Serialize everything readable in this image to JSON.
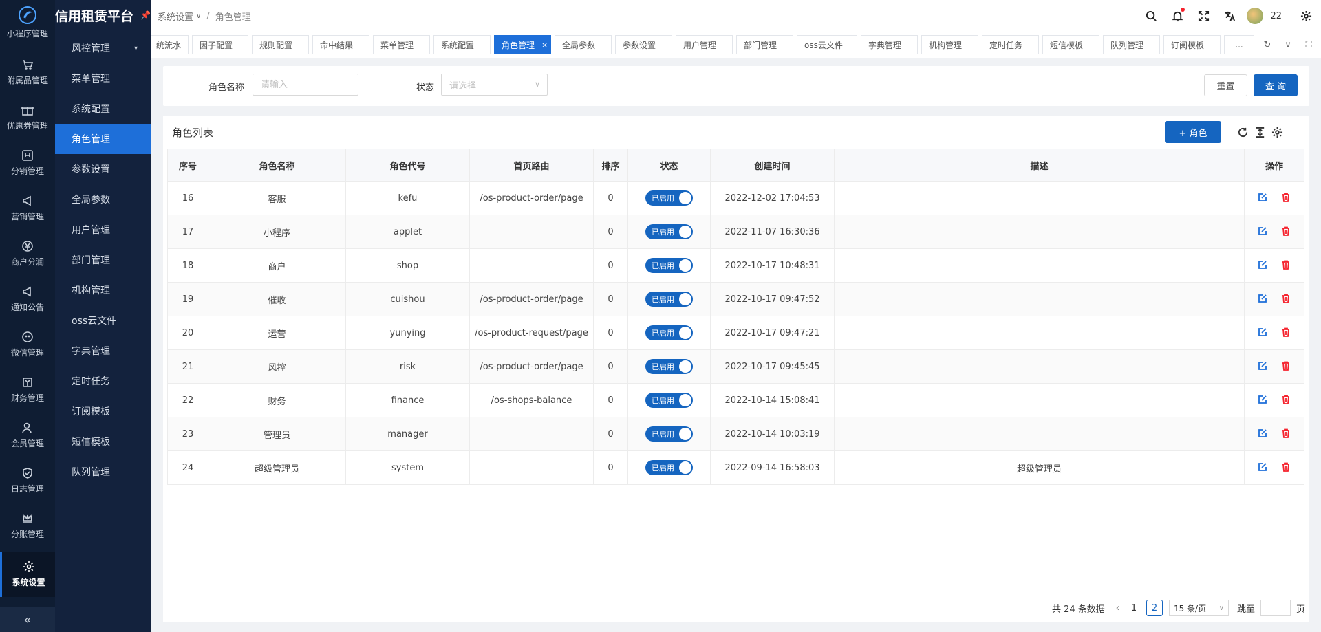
{
  "rail": {
    "items": [
      {
        "label": "小程序管理"
      },
      {
        "label": "附属品管理"
      },
      {
        "label": "优惠券管理"
      },
      {
        "label": "分销管理"
      },
      {
        "label": "营销管理"
      },
      {
        "label": "商户分润"
      },
      {
        "label": "通知公告"
      },
      {
        "label": "微信管理"
      },
      {
        "label": "财务管理"
      },
      {
        "label": "会员管理"
      },
      {
        "label": "日志管理"
      },
      {
        "label": "分账管理"
      },
      {
        "label": "系统设置"
      }
    ],
    "collapse": "«"
  },
  "sidebar": {
    "brand": "信用租赁平台",
    "items": [
      {
        "label": "风控管理"
      },
      {
        "label": "菜单管理"
      },
      {
        "label": "系统配置"
      },
      {
        "label": "角色管理"
      },
      {
        "label": "参数设置"
      },
      {
        "label": "全局参数"
      },
      {
        "label": "用户管理"
      },
      {
        "label": "部门管理"
      },
      {
        "label": "机构管理"
      },
      {
        "label": "oss云文件"
      },
      {
        "label": "字典管理"
      },
      {
        "label": "定时任务"
      },
      {
        "label": "订阅模板"
      },
      {
        "label": "短信模板"
      },
      {
        "label": "队列管理"
      }
    ]
  },
  "header": {
    "breadcrumb_parent": "系统设置",
    "breadcrumb_current": "角色管理",
    "user_name": "22"
  },
  "tabs": [
    {
      "label": "统流水"
    },
    {
      "label": "因子配置"
    },
    {
      "label": "规则配置"
    },
    {
      "label": "命中结果"
    },
    {
      "label": "菜单管理"
    },
    {
      "label": "系统配置"
    },
    {
      "label": "角色管理"
    },
    {
      "label": "全局参数"
    },
    {
      "label": "参数设置"
    },
    {
      "label": "用户管理"
    },
    {
      "label": "部门管理"
    },
    {
      "label": "oss云文件"
    },
    {
      "label": "字典管理"
    },
    {
      "label": "机构管理"
    },
    {
      "label": "定时任务"
    },
    {
      "label": "短信模板"
    },
    {
      "label": "队列管理"
    },
    {
      "label": "订阅模板"
    }
  ],
  "tab_more": "...",
  "search": {
    "role_name_label": "角色名称",
    "role_name_placeholder": "请输入",
    "status_label": "状态",
    "status_placeholder": "请选择",
    "reset_label": "重置",
    "query_label": "查 询"
  },
  "table": {
    "title": "角色列表",
    "add_label": "+ 角色",
    "columns": [
      "序号",
      "角色名称",
      "角色代号",
      "首页路由",
      "排序",
      "状态",
      "创建时间",
      "描述",
      "操作"
    ],
    "status_text": "已启用",
    "rows": [
      {
        "id": "16",
        "name": "客服",
        "code": "kefu",
        "route": "/os-product-order/page",
        "sort": "0",
        "created": "2022-12-02 17:04:53",
        "desc": ""
      },
      {
        "id": "17",
        "name": "小程序",
        "code": "applet",
        "route": "",
        "sort": "0",
        "created": "2022-11-07 16:30:36",
        "desc": ""
      },
      {
        "id": "18",
        "name": "商户",
        "code": "shop",
        "route": "",
        "sort": "0",
        "created": "2022-10-17 10:48:31",
        "desc": ""
      },
      {
        "id": "19",
        "name": "催收",
        "code": "cuishou",
        "route": "/os-product-order/page",
        "sort": "0",
        "created": "2022-10-17 09:47:52",
        "desc": ""
      },
      {
        "id": "20",
        "name": "运营",
        "code": "yunying",
        "route": "/os-product-request/page",
        "sort": "0",
        "created": "2022-10-17 09:47:21",
        "desc": ""
      },
      {
        "id": "21",
        "name": "风控",
        "code": "risk",
        "route": "/os-product-order/page",
        "sort": "0",
        "created": "2022-10-17 09:45:45",
        "desc": ""
      },
      {
        "id": "22",
        "name": "财务",
        "code": "finance",
        "route": "/os-shops-balance",
        "sort": "0",
        "created": "2022-10-14 15:08:41",
        "desc": ""
      },
      {
        "id": "23",
        "name": "管理员",
        "code": "manager",
        "route": "",
        "sort": "0",
        "created": "2022-10-14 10:03:19",
        "desc": ""
      },
      {
        "id": "24",
        "name": "超级管理员",
        "code": "system",
        "route": "",
        "sort": "0",
        "created": "2022-09-14 16:58:03",
        "desc": "超级管理员"
      }
    ]
  },
  "pagination": {
    "total_text": "共 24 条数据",
    "page1": "1",
    "page2": "2",
    "page_size": "15 条/页",
    "jump_label": "跳至",
    "page_suffix": "页"
  },
  "colors": {
    "primary": "#1565c0",
    "danger": "#f5222d",
    "rail_bg": "#0f1d33",
    "sidebar_bg": "#13223d"
  }
}
